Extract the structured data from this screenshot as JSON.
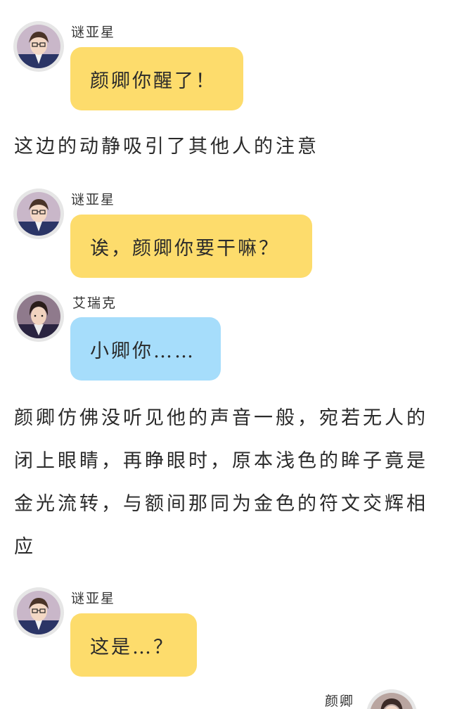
{
  "messages": [
    {
      "speaker": "谜亚星",
      "text": "颜卿你醒了！",
      "color": "#fddc6c"
    },
    {
      "speaker": "谜亚星",
      "text": "诶，颜卿你要干嘛？",
      "color": "#fddc6c"
    },
    {
      "speaker": "艾瑞克",
      "text": "小卿你……",
      "color": "#a6ddfb"
    },
    {
      "speaker": "谜亚星",
      "text": "这是…？",
      "color": "#fddc6c"
    },
    {
      "speaker": "颜卿"
    }
  ],
  "narrations": [
    "这边的动静吸引了其他人的注意",
    "颜卿仿佛没听见他的声音一般，宛若无人的闭上眼睛，再睁眼时，原本浅色的眸子竟是金光流转，与额间那同为金色的符文交辉相应"
  ]
}
